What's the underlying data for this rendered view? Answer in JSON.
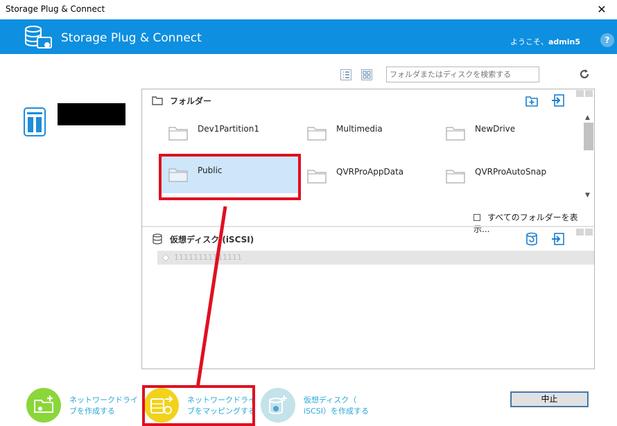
{
  "window": {
    "title": "Storage Plug & Connect",
    "close_glyph": "✕"
  },
  "header": {
    "app_title": "Storage Plug & Connect",
    "welcome_prefix": "ようこそ、",
    "username": "admin5",
    "help_glyph": "?",
    "color": "#0f8fdf"
  },
  "toolbar": {
    "search_placeholder": "フォルダまたはディスクを検索する",
    "icons": [
      "list-view-icon",
      "grid-view-icon",
      "refresh-icon"
    ]
  },
  "folders_section": {
    "title": "フォルダー",
    "items": [
      {
        "name": "Dev1Partition1",
        "selected": false
      },
      {
        "name": "Multimedia",
        "selected": false
      },
      {
        "name": "NewDrive",
        "selected": false
      },
      {
        "name": "Public",
        "selected": true
      },
      {
        "name": "QVRProAppData",
        "selected": false
      },
      {
        "name": "QVRProAutoSnap",
        "selected": false
      }
    ],
    "show_all_label": "すべてのフォルダーを表示..."
  },
  "vdisk_section": {
    "title": "仮想ディスク (iSCSI)",
    "items": [
      {
        "name": "11111111111111"
      }
    ]
  },
  "actions": [
    {
      "line1": "ネットワークドライ",
      "line2": "ブを作成する",
      "color": "#8bd63a"
    },
    {
      "line1": "ネットワークドライ",
      "line2": "ブをマッピングする",
      "color": "#f3d21c"
    },
    {
      "line1": "仮想ディスク（",
      "line2": "iSCSI）を作成する",
      "color": "#c4e2ea"
    }
  ],
  "cancel_label": "中止",
  "annotation_color": "#e01020"
}
